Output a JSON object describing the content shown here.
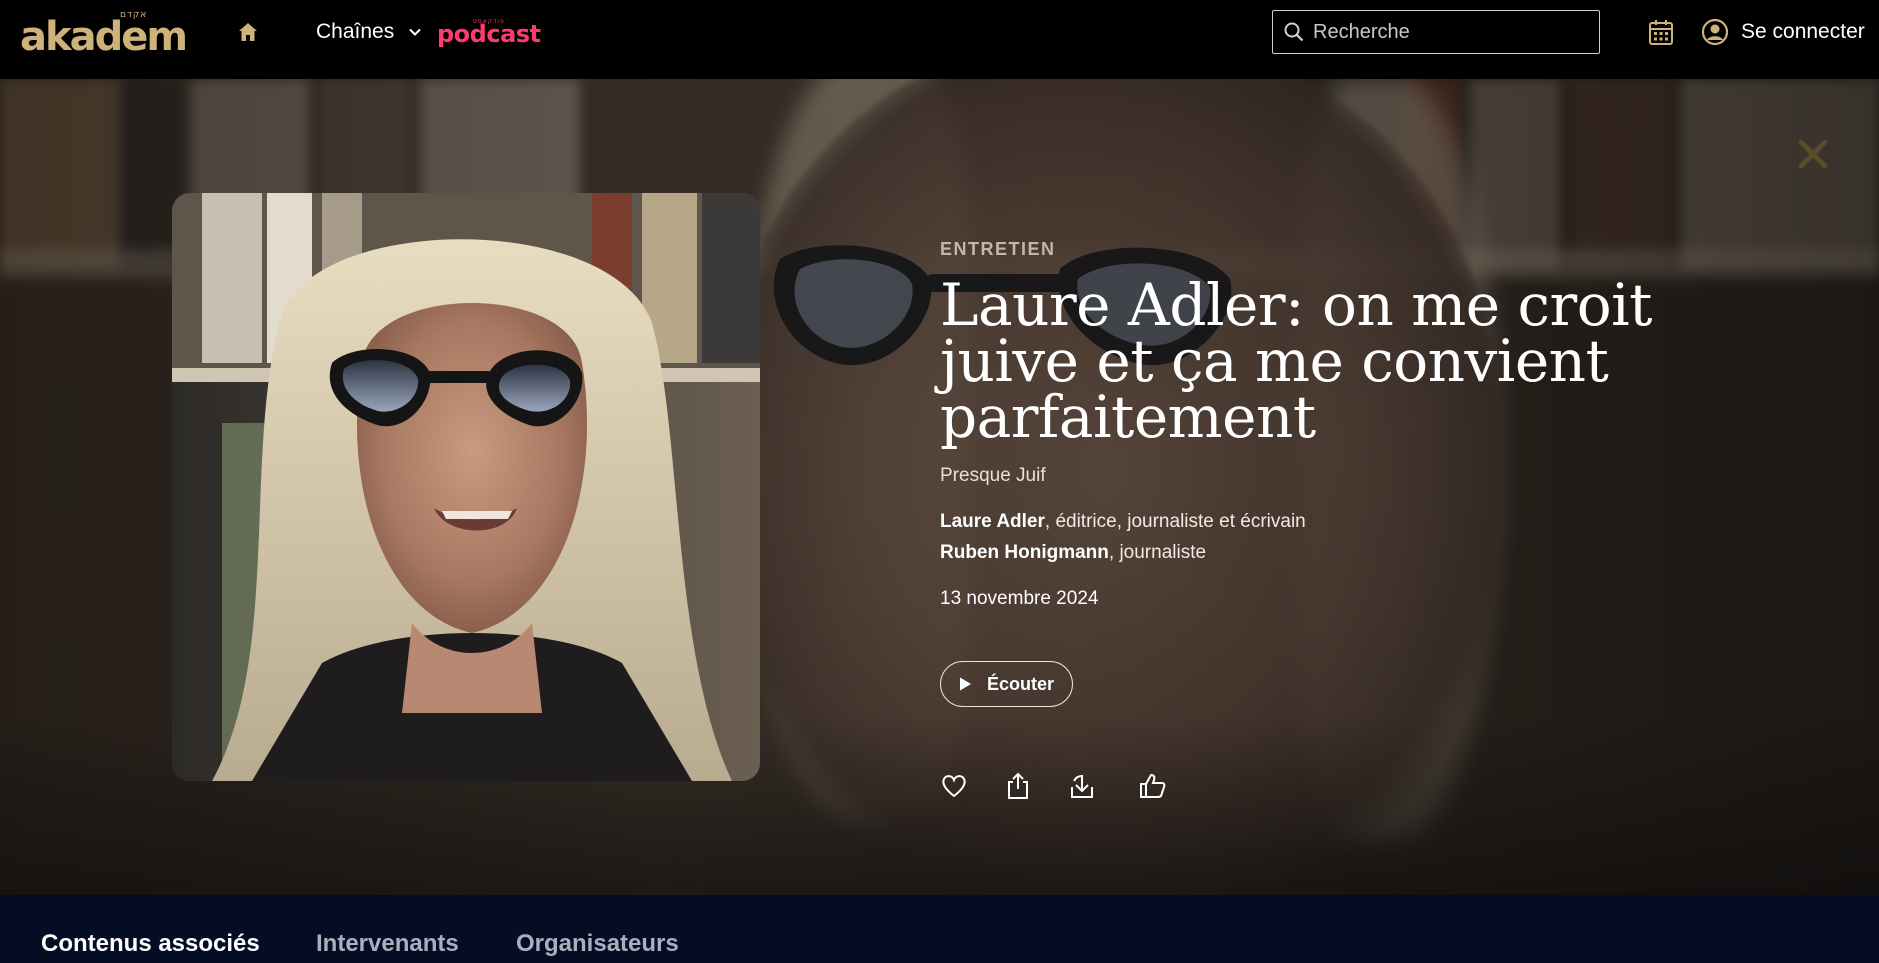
{
  "nav": {
    "logo_text": "akadem",
    "logo_hebrew": "אקדם",
    "channels_label": "Chaînes",
    "podcast_label": "podcast",
    "podcast_tiny": "פודקאסט",
    "search_placeholder": "Recherche",
    "login_label": "Se connecter",
    "colors": {
      "logo": "#cdb27a",
      "podcast": "#ff3b6b"
    }
  },
  "hero": {
    "kicker": "ENTRETIEN",
    "title": "Laure Adler: on me croit juive et ça me convient parfaitement",
    "program": "Presque Juif",
    "speakers": [
      {
        "name": "Laure Adler",
        "role": ", éditrice, journaliste et écrivain"
      },
      {
        "name": "Ruben Honigmann",
        "role": ", journaliste"
      }
    ],
    "date": "13 novembre 2024",
    "listen_label": "Écouter",
    "actions": [
      "heart-icon",
      "share-icon",
      "download-icon",
      "thumbs-up-icon"
    ]
  },
  "tabs": [
    {
      "label": "Contenus associés",
      "active": true
    },
    {
      "label": "Intervenants",
      "active": false
    },
    {
      "label": "Organisateurs",
      "active": false
    }
  ]
}
